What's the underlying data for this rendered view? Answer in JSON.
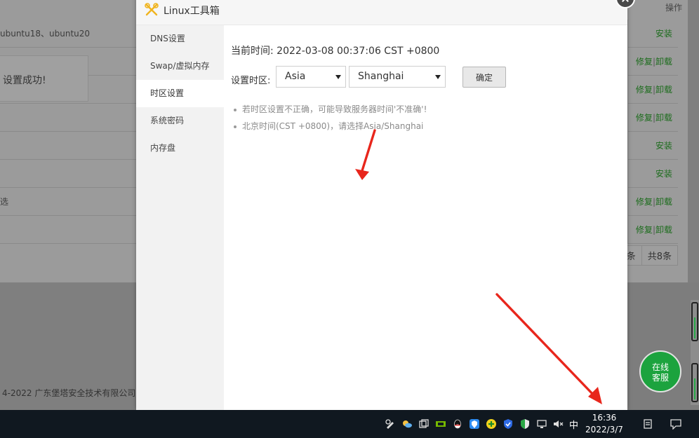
{
  "background_page": {
    "header_op": "操作",
    "rows": [
      {
        "left": "ubuntu18、ubuntu20",
        "ops": [
          "安装"
        ]
      },
      {
        "left": "",
        "ops": [
          "修复",
          "卸载"
        ]
      },
      {
        "left": "",
        "ops": [
          "修复",
          "卸载"
        ]
      },
      {
        "left": "",
        "ops": [
          "修复",
          "卸载"
        ]
      },
      {
        "left": "",
        "ops": [
          "安装"
        ]
      },
      {
        "left": "",
        "ops": [
          "安装"
        ]
      },
      {
        "left": "选",
        "ops": [
          "修复",
          "卸载"
        ]
      },
      {
        "left": "",
        "ops": [
          "修复",
          "卸载"
        ]
      }
    ],
    "op_separator": "|",
    "pager": [
      "条",
      "共8条"
    ],
    "footer": "4-2022 广东堡塔安全技术有限公司",
    "toast": "设置成功!"
  },
  "dialog": {
    "title": "Linux工具箱",
    "nav": [
      {
        "label": "DNS设置",
        "active": false
      },
      {
        "label": "Swap/虚拟内存",
        "active": false
      },
      {
        "label": "时区设置",
        "active": true
      },
      {
        "label": "系统密码",
        "active": false
      },
      {
        "label": "内存盘",
        "active": false
      }
    ],
    "current_time_label": "当前时间: 2022-03-08 00:37:06 CST +0800",
    "timezone_label": "设置时区:",
    "region_select": "Asia",
    "city_select": "Shanghai",
    "confirm_button": "确定",
    "tips": [
      "若时区设置不正确，可能导致服务器时间'不准确'!",
      "北京时间(CST +0800)，请选择Asia/Shanghai"
    ]
  },
  "online_service": {
    "line1": "在线",
    "line2": "客服"
  },
  "taskbar": {
    "ime": "中",
    "time": "16:36",
    "date": "2022/3/7",
    "tray_icons": [
      "weather-icon",
      "task-view-icon",
      "nvidia-icon",
      "qq-icon",
      "security-shield-icon",
      "add-icon",
      "defender-icon",
      "shield-check-icon",
      "network-icon",
      "mute-icon"
    ]
  },
  "colors": {
    "accent_green": "#1ca33e",
    "arrow_red": "#e8261c",
    "taskbar": "#101820"
  }
}
